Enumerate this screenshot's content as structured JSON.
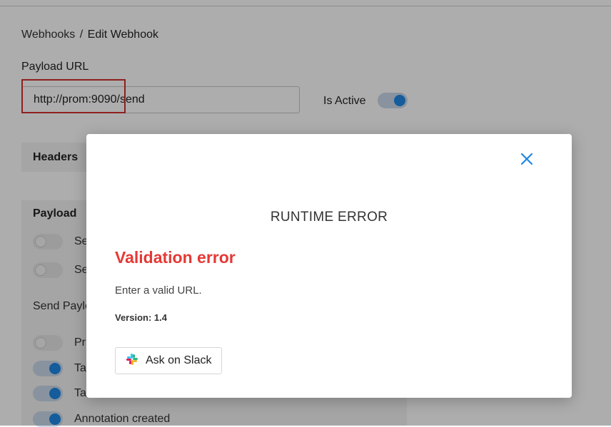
{
  "breadcrumb": {
    "parent": "Webhooks",
    "separator": "/",
    "current": "Edit Webhook"
  },
  "form": {
    "payload_url_label": "Payload URL",
    "payload_url_value": "http://prom:9090/send",
    "is_active_label": "Is Active",
    "is_active": true
  },
  "sections": {
    "headers_title": "Headers",
    "payload_title": "Payload",
    "payload_options": [
      {
        "label": "Se",
        "enabled": false
      },
      {
        "label": "Se",
        "enabled": false
      }
    ],
    "send_payload_title": "Send Paylo",
    "send_payload_options": [
      {
        "label": "Pr",
        "enabled": false
      },
      {
        "label": "Ta",
        "enabled": true
      },
      {
        "label": "Ta",
        "enabled": true
      },
      {
        "label": "Annotation created",
        "enabled": true
      }
    ]
  },
  "modal": {
    "heading": "RUNTIME ERROR",
    "error_title": "Validation error",
    "error_message": "Enter a valid URL.",
    "version_label": "Version:",
    "version_value": "1.4",
    "slack_button_label": "Ask on Slack",
    "close_icon": "close-icon",
    "slack_icon": "slack-icon"
  },
  "colors": {
    "accent": "#1e88e5",
    "error": "#e53935",
    "highlight": "#d32f2f"
  }
}
